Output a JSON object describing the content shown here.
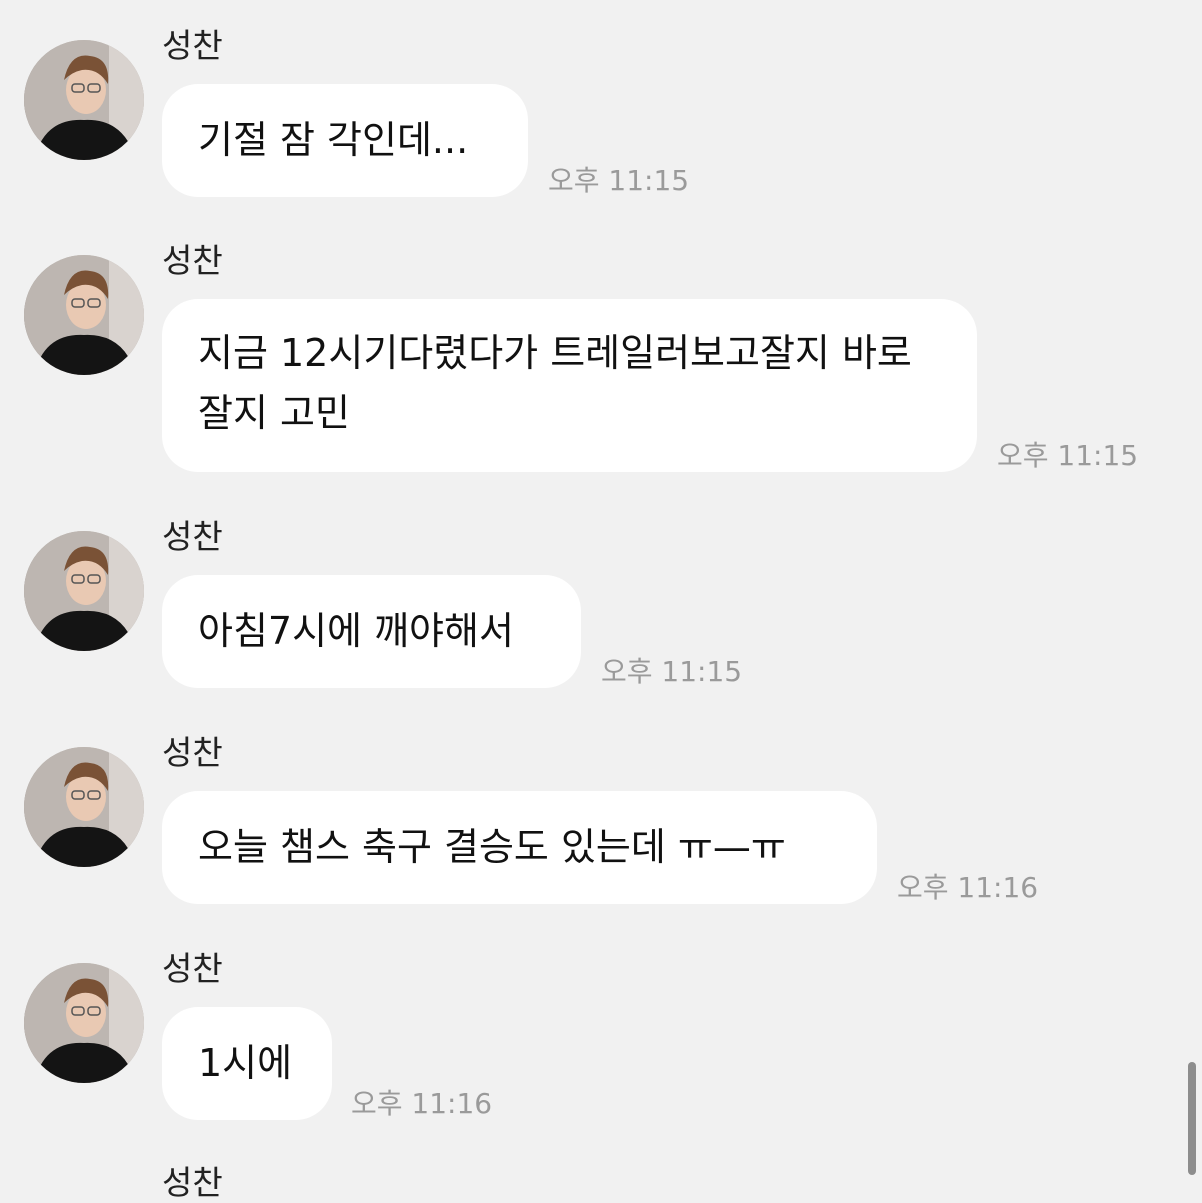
{
  "messages": [
    {
      "sender": "성찬",
      "text": "기절 잠 각인데...",
      "time": "오후 11:15"
    },
    {
      "sender": "성찬",
      "text": "지금 12시기다렸다가 트레일러보고잘지 바로 잘지 고민",
      "time": "오후 11:15"
    },
    {
      "sender": "성찬",
      "text": "아침7시에 깨야해서",
      "time": "오후 11:15"
    },
    {
      "sender": "성찬",
      "text": "오늘 챔스 축구 결승도 있는데 ㅠ—ㅠ",
      "time": "오후 11:16"
    },
    {
      "sender": "성찬",
      "text": "1시에",
      "time": "오후 11:16"
    }
  ],
  "next_sender": "성찬"
}
